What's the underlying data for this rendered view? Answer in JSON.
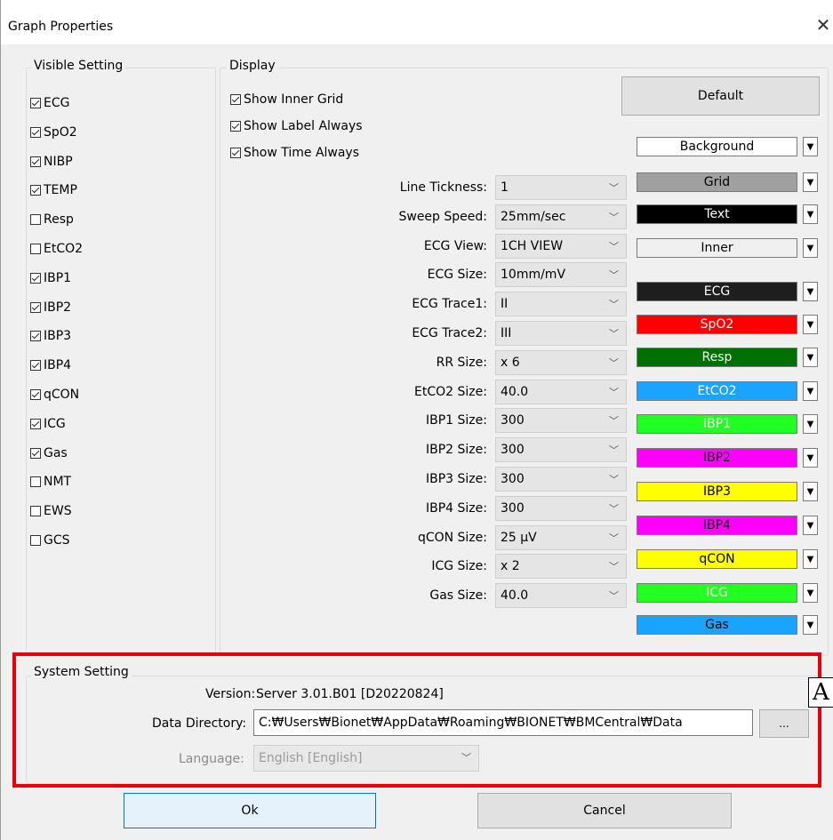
{
  "window": {
    "title": "Graph Properties",
    "close_glyph": "✕"
  },
  "visible_setting": {
    "label": "Visible Setting",
    "items": [
      {
        "label": "ECG",
        "checked": true
      },
      {
        "label": "SpO2",
        "checked": true
      },
      {
        "label": "NIBP",
        "checked": true
      },
      {
        "label": "TEMP",
        "checked": true
      },
      {
        "label": "Resp",
        "checked": false
      },
      {
        "label": "EtCO2",
        "checked": false
      },
      {
        "label": "IBP1",
        "checked": true
      },
      {
        "label": "IBP2",
        "checked": true
      },
      {
        "label": "IBP3",
        "checked": true
      },
      {
        "label": "IBP4",
        "checked": true
      },
      {
        "label": "qCON",
        "checked": true
      },
      {
        "label": "ICG",
        "checked": true
      },
      {
        "label": "Gas",
        "checked": true
      },
      {
        "label": "NMT",
        "checked": false
      },
      {
        "label": "EWS",
        "checked": false
      },
      {
        "label": "GCS",
        "checked": false
      }
    ]
  },
  "display": {
    "label": "Display",
    "default_button": "Default",
    "checkboxes": [
      {
        "label": "Show Inner Grid",
        "checked": true
      },
      {
        "label": "Show Label Always",
        "checked": true
      },
      {
        "label": "Show Time Always",
        "checked": true
      }
    ],
    "settings": [
      {
        "label": "Line Tickness:",
        "value": "1"
      },
      {
        "label": "Sweep Speed:",
        "value": "25mm/sec"
      },
      {
        "label": "ECG View:",
        "value": "1CH VIEW"
      },
      {
        "label": "ECG Size:",
        "value": "10mm/mV"
      },
      {
        "label": "ECG Trace1:",
        "value": "II"
      },
      {
        "label": "ECG Trace2:",
        "value": "III"
      },
      {
        "label": "RR Size:",
        "value": "x 6"
      },
      {
        "label": "EtCO2 Size:",
        "value": "40.0"
      },
      {
        "label": "IBP1 Size:",
        "value": "300"
      },
      {
        "label": "IBP2 Size:",
        "value": "300"
      },
      {
        "label": "IBP3 Size:",
        "value": "300"
      },
      {
        "label": "IBP4 Size:",
        "value": "300"
      },
      {
        "label": "qCON Size:",
        "value": "25 μV"
      },
      {
        "label": "ICG Size:",
        "value": "x 2"
      },
      {
        "label": "Gas Size:",
        "value": "40.0"
      }
    ],
    "colors": [
      {
        "label": "Background",
        "bg": "#ffffff",
        "fg": "#000000"
      },
      {
        "label": "Grid",
        "bg": "#a0a0a0",
        "fg": "#000000"
      },
      {
        "label": "Text",
        "bg": "#000000",
        "fg": "#ffffff"
      },
      {
        "label": "Inner",
        "bg": "#f0f0f0",
        "fg": "#000000"
      },
      {
        "label": "ECG",
        "bg": "#1e1e1e",
        "fg": "#ffffff"
      },
      {
        "label": "SpO2",
        "bg": "#ff0000",
        "fg": "#ffffff"
      },
      {
        "label": "Resp",
        "bg": "#007000",
        "fg": "#ffffff"
      },
      {
        "label": "EtCO2",
        "bg": "#1aa3ff",
        "fg": "#ffffff"
      },
      {
        "label": "IBP1",
        "bg": "#22ff22",
        "fg": "#ffffff"
      },
      {
        "label": "IBP2",
        "bg": "#ff00ff",
        "fg": "#000000"
      },
      {
        "label": "IBP3",
        "bg": "#ffff00",
        "fg": "#000000"
      },
      {
        "label": "IBP4",
        "bg": "#ff00ff",
        "fg": "#000000"
      },
      {
        "label": "qCON",
        "bg": "#ffff00",
        "fg": "#000000"
      },
      {
        "label": "ICG",
        "bg": "#22ff22",
        "fg": "#ffffff"
      },
      {
        "label": "Gas",
        "bg": "#1aa3ff",
        "fg": "#000000"
      }
    ]
  },
  "system": {
    "label": "System Setting",
    "version_label": "Version:",
    "version_value": "Server 3.01.B01 [D20220824]",
    "datadir_label": "Data Directory:",
    "datadir_value": "C:₩Users₩Bionet₩AppData₩Roaming₩BIONET₩BMCentral₩Data",
    "browse_label": "...",
    "language_label": "Language:",
    "language_value": "English [English]",
    "annotation": "A"
  },
  "footer": {
    "ok_label": "Ok",
    "cancel_label": "Cancel"
  }
}
